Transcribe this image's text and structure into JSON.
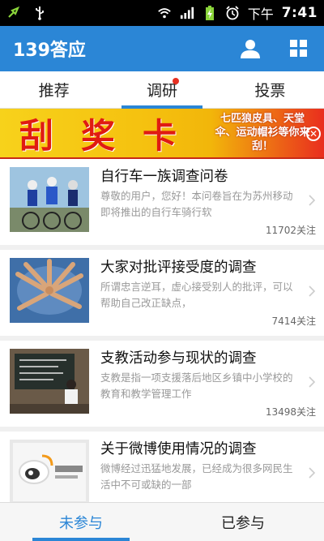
{
  "status_bar": {
    "ampm": "下午",
    "time": "7:41",
    "icons": [
      "usb-sync-icon",
      "usb-icon",
      "wifi-icon",
      "signal-icon",
      "battery-charging-icon",
      "alarm-icon"
    ]
  },
  "app": {
    "title": "139答应",
    "accent": "#2b86d6",
    "actions": [
      "user-icon",
      "grid-icon"
    ]
  },
  "tabs": [
    {
      "label": "推荐",
      "active": false
    },
    {
      "label": "调研",
      "active": true,
      "badge": true
    },
    {
      "label": "投票",
      "active": false
    }
  ],
  "banner": {
    "title": "刮奖卡",
    "text": "七匹狼皮具、天堂伞、运动帽衫等你来刮！"
  },
  "items": [
    {
      "title": "自行车一族调查问卷",
      "desc": "尊敬的用户，您好！本问卷旨在为苏州移动即将推出的自行车骑行软",
      "follow": "11702关注",
      "thumb": "cyclists-photo"
    },
    {
      "title": "大家对批评接受度的调查",
      "desc": "所谓忠言逆耳，虚心接受别人的批评，可以帮助自己改正缺点，",
      "follow": "7414关注",
      "thumb": "hands-circle-photo"
    },
    {
      "title": "支教活动参与现状的调查",
      "desc": "支教是指一项支援落后地区乡镇中小学校的教育和教学管理工作",
      "follow": "13498关注",
      "thumb": "classroom-photo"
    },
    {
      "title": "关于微博使用情况的调查",
      "desc": "微博经过迅猛地发展，已经成为很多网民生活中不可或缺的一部",
      "follow": "",
      "thumb": "weibo-logo-photo"
    }
  ],
  "bottom_tabs": [
    {
      "label": "未参与",
      "active": true
    },
    {
      "label": "已参与",
      "active": false
    }
  ]
}
